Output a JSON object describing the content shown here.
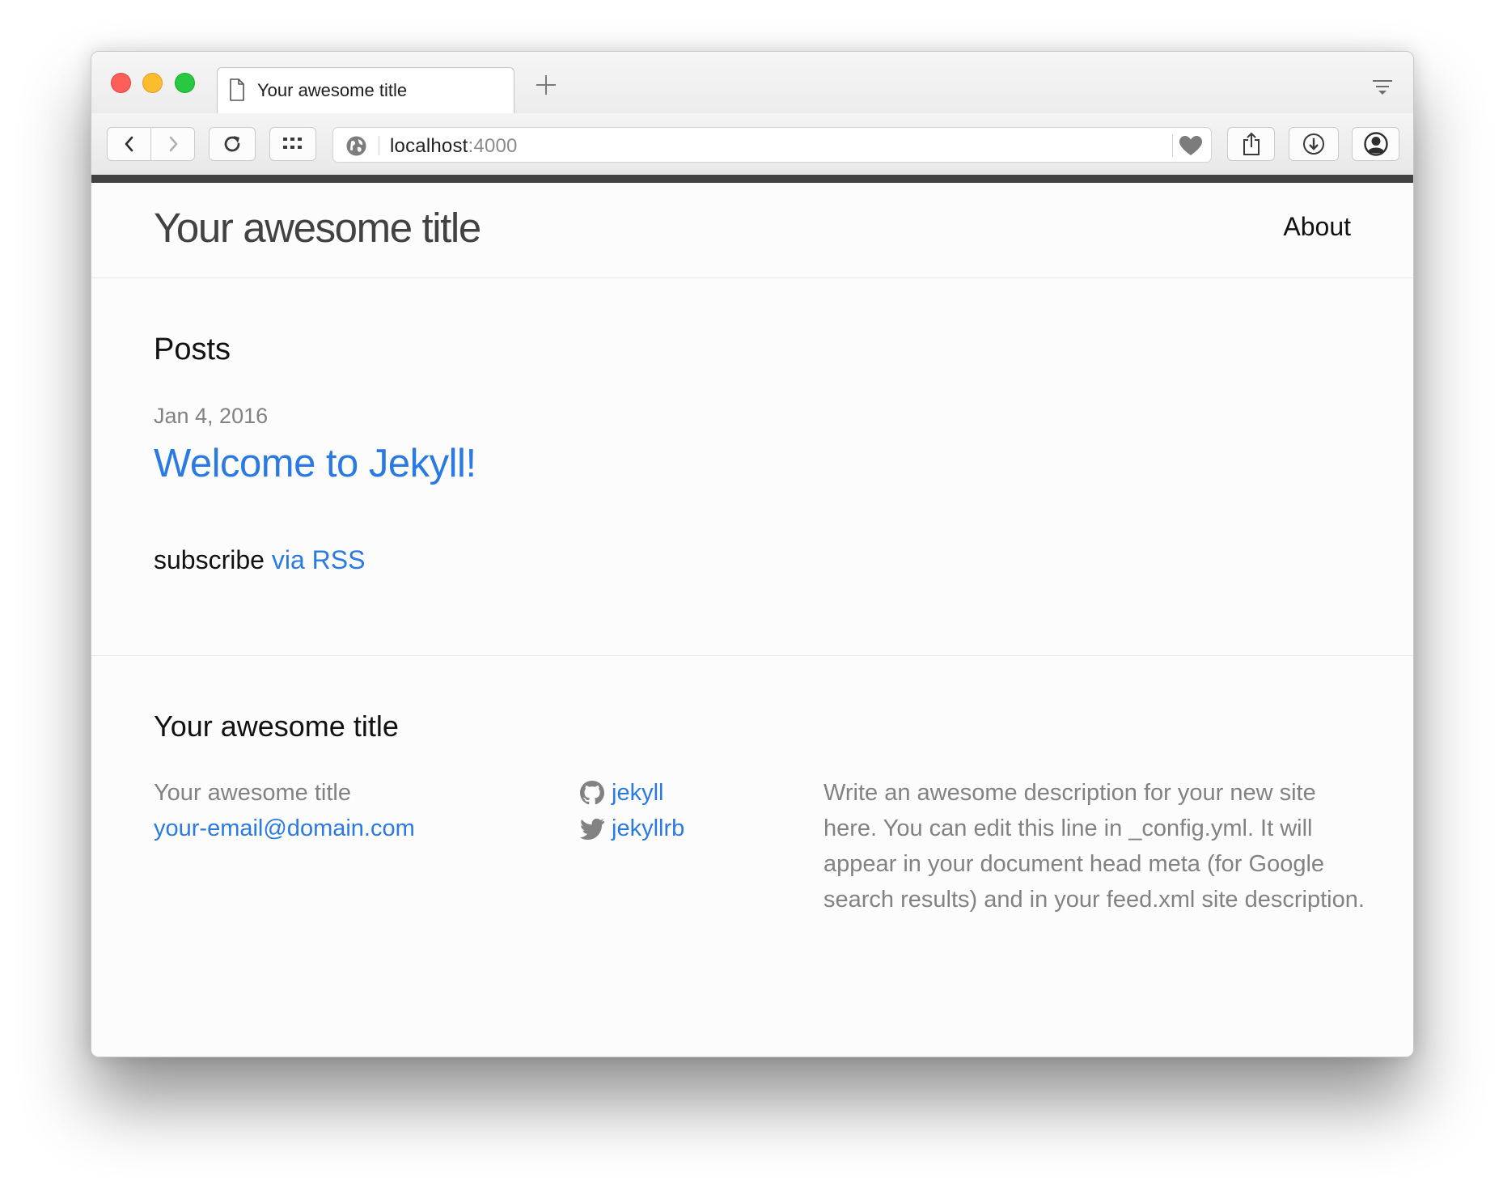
{
  "browser": {
    "tab_title": "Your awesome title",
    "url_host": "localhost",
    "url_port": ":4000"
  },
  "site": {
    "title": "Your awesome title",
    "nav": [
      {
        "label": "About"
      }
    ]
  },
  "main": {
    "heading": "Posts",
    "posts": [
      {
        "date": "Jan 4, 2016",
        "title": "Welcome to Jekyll!"
      }
    ],
    "subscribe_text": "subscribe",
    "subscribe_link": "via RSS"
  },
  "footer": {
    "heading": "Your awesome title",
    "name": "Your awesome title",
    "email": "your-email@domain.com",
    "github": "jekyll",
    "twitter": "jekyllrb",
    "description": "Write an awesome description for your new site here. You can edit this line in _config.yml. It will appear in your document head meta (for Google search results) and in your feed.xml site description."
  },
  "colors": {
    "link": "#2a7ae2",
    "meta_grey": "#828282",
    "header_bar": "#424242"
  },
  "icons": {
    "tab": "page-icon",
    "new_tab": "plus-icon",
    "tab_overview": "tabs-menu-icon",
    "back": "chevron-left-icon",
    "forward": "chevron-right-icon",
    "reload": "reload-icon",
    "top_sites": "grid-icon",
    "site_identity": "globe-icon",
    "favorite": "heart-icon",
    "share": "share-icon",
    "downloads": "download-icon",
    "account": "account-icon",
    "github": "github-icon",
    "twitter": "twitter-icon"
  }
}
